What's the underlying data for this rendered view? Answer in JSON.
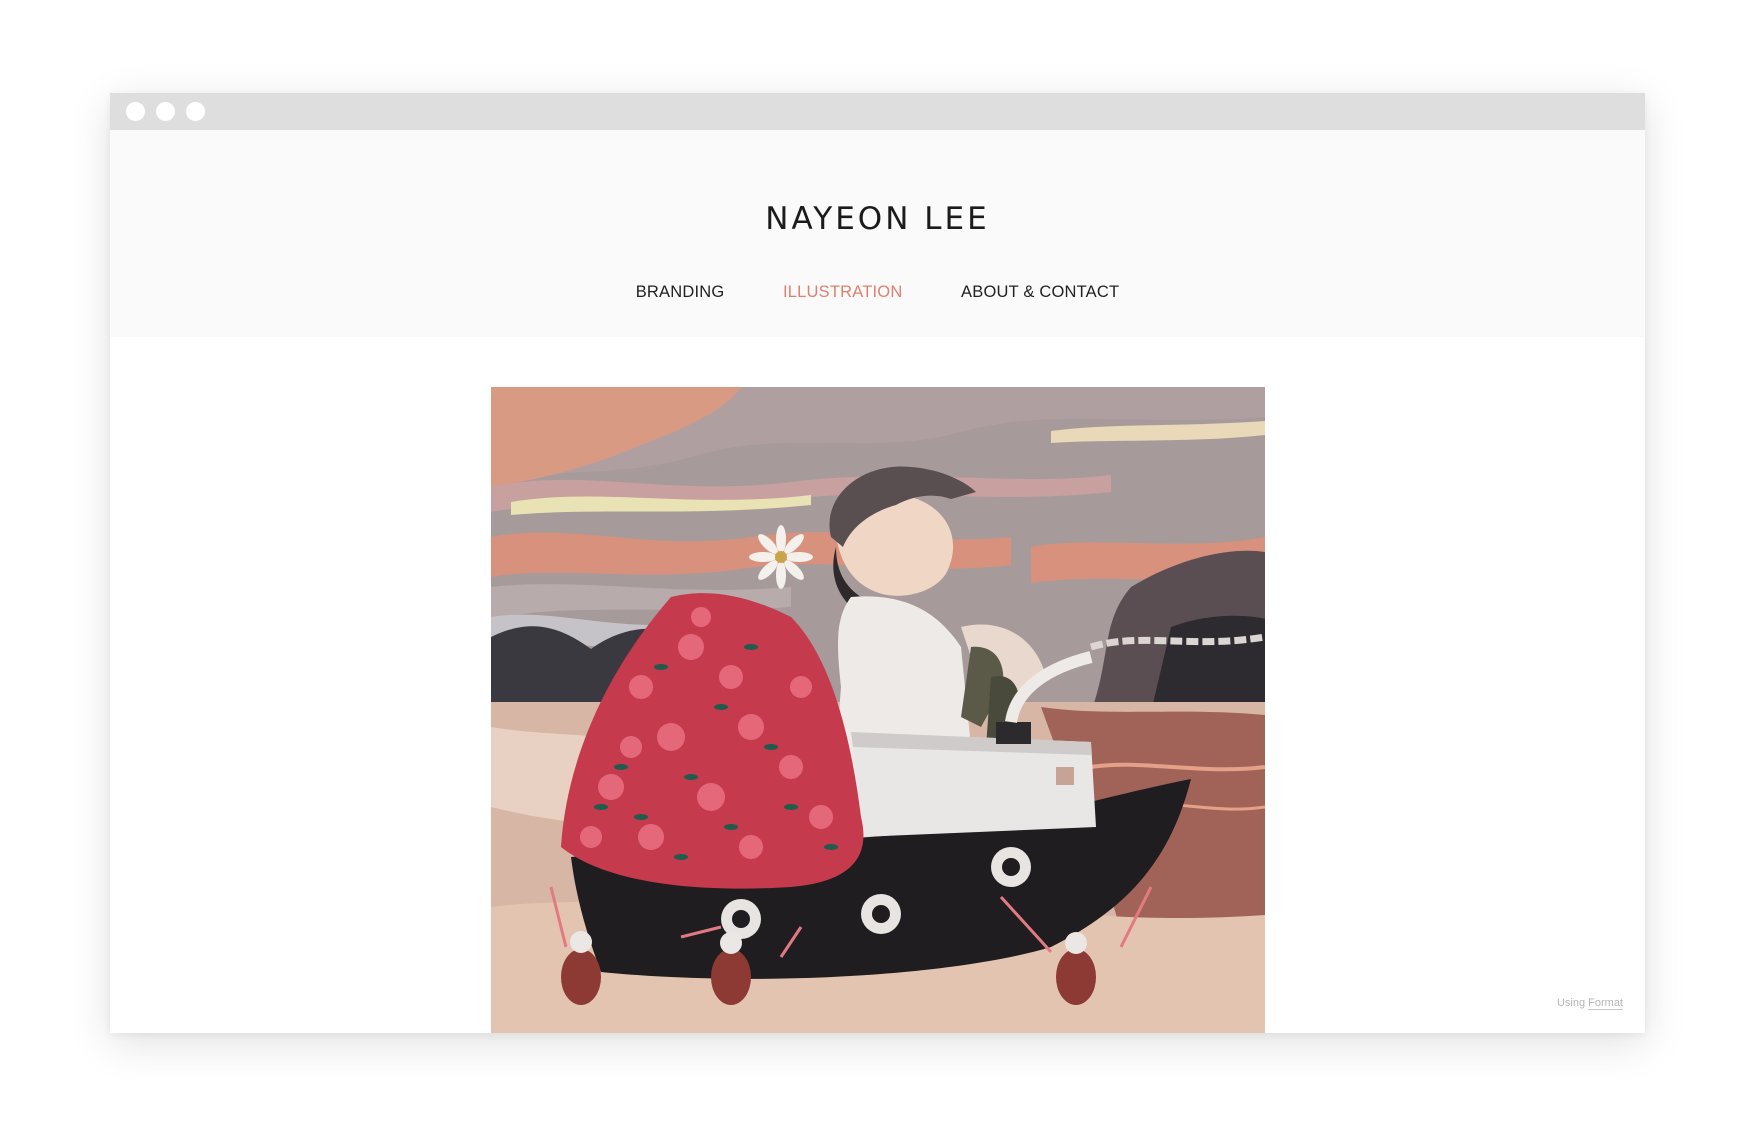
{
  "window": {
    "controls": [
      "close",
      "minimize",
      "maximize"
    ]
  },
  "site": {
    "title": "NAYEON LEE"
  },
  "nav": {
    "items": [
      {
        "label": "BRANDING",
        "active": false
      },
      {
        "label": "ILLUSTRATION",
        "active": true
      },
      {
        "label": "ABOUT & CONTACT",
        "active": false
      }
    ]
  },
  "artwork": {
    "description_icon": "illustration-image"
  },
  "footer": {
    "using": "Using",
    "platform": "Format"
  },
  "colors": {
    "accent": "#e07f6d",
    "header_bg": "#fafafa",
    "titlebar": "#dedede"
  }
}
